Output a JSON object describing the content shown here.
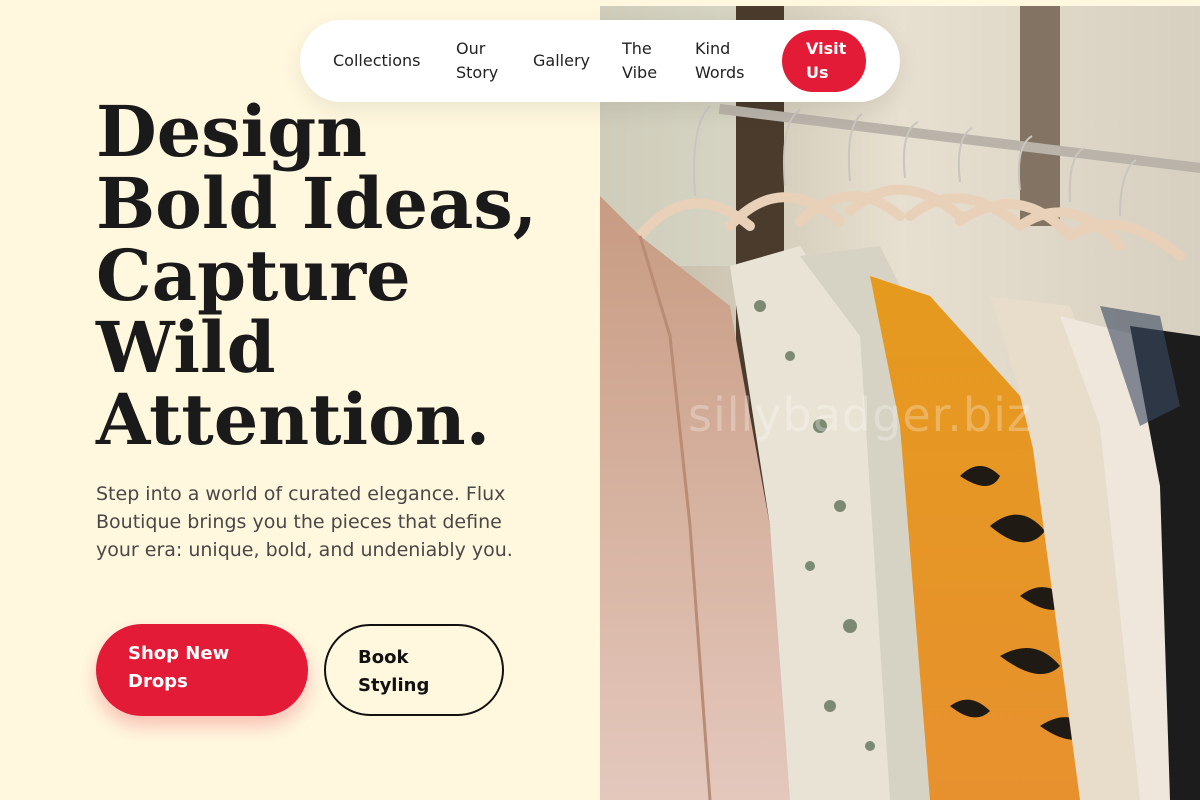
{
  "nav": {
    "items": [
      {
        "label": "Collections"
      },
      {
        "label": "Our Story"
      },
      {
        "label": "Gallery"
      },
      {
        "label": "The Vibe"
      },
      {
        "label": "Kind Words"
      }
    ],
    "cta_label": "Visit Us"
  },
  "hero": {
    "headline": "Design Bold Ideas, Capture Wild Attention.",
    "intro": "Step into a world of curated elegance. Flux Boutique brings you the pieces that define your era: unique, bold, and undeniably you.",
    "primary_button": "Shop New Drops",
    "secondary_button": "Book Styling"
  },
  "photo": {
    "watermark": "sillybadger.biz"
  },
  "colors": {
    "accent": "#e31b37",
    "background": "#fff8df",
    "text": "#1a1a1a"
  }
}
